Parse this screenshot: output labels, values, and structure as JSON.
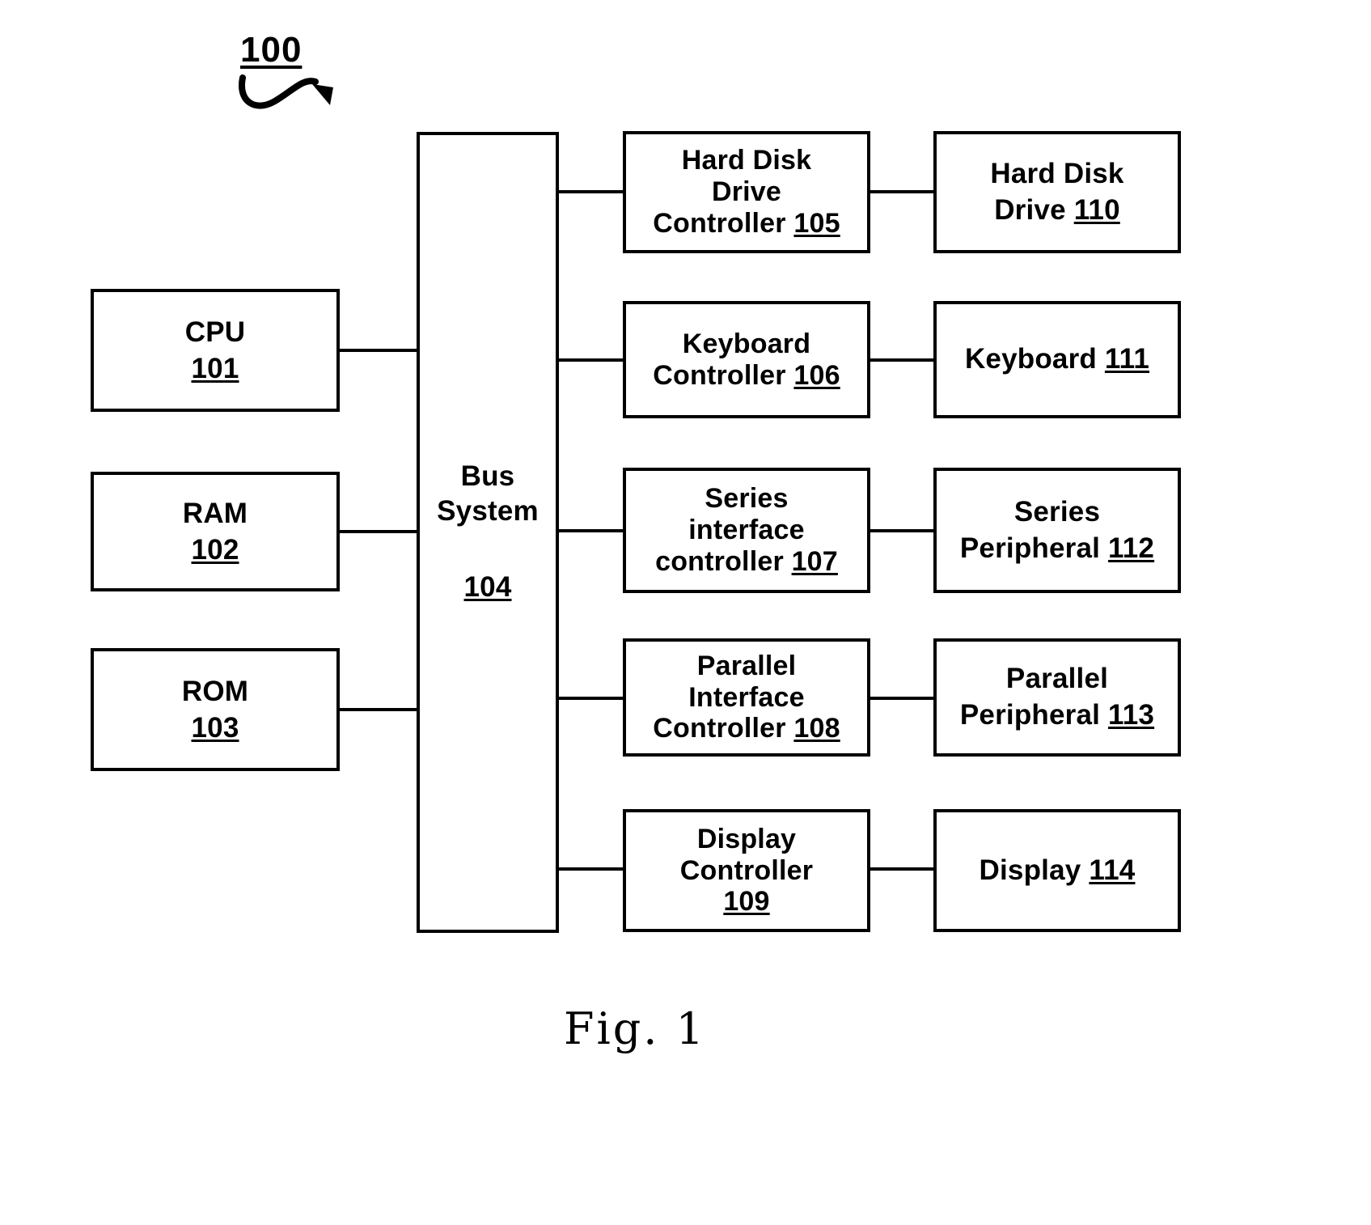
{
  "figure": {
    "reference_label": "100",
    "caption": "Fig. 1"
  },
  "left_column": [
    {
      "name": "cpu",
      "line1": "CPU",
      "ref": "101"
    },
    {
      "name": "ram",
      "line1": "RAM",
      "ref": "102"
    },
    {
      "name": "rom",
      "line1": "ROM",
      "ref": "103"
    }
  ],
  "bus": {
    "line1": "Bus",
    "line2": "System",
    "ref": "104"
  },
  "controllers": [
    {
      "name": "hard-disk-drive-controller",
      "line1": "Hard Disk",
      "line2": "Drive",
      "line3": "Controller",
      "ref": "105"
    },
    {
      "name": "keyboard-controller",
      "line1": "Keyboard",
      "line2": "Controller",
      "ref": "106"
    },
    {
      "name": "series-interface-controller",
      "line1": "Series",
      "line2": "interface",
      "line3": "controller",
      "ref": "107"
    },
    {
      "name": "parallel-interface-controller",
      "line1": "Parallel",
      "line2": "Interface",
      "line3": "Controller",
      "ref": "108"
    },
    {
      "name": "display-controller",
      "line1": "Display",
      "line2": "Controller",
      "ref": "109"
    }
  ],
  "devices": [
    {
      "name": "hard-disk-drive",
      "line1": "Hard Disk",
      "line2": "Drive",
      "ref": "110"
    },
    {
      "name": "keyboard",
      "line1": "Keyboard",
      "ref": "111"
    },
    {
      "name": "series-peripheral",
      "line1": "Series",
      "line2": "Peripheral",
      "ref": "112"
    },
    {
      "name": "parallel-peripheral",
      "line1": "Parallel",
      "line2": "Peripheral",
      "ref": "113"
    },
    {
      "name": "display",
      "line1": "Display",
      "ref": "114"
    }
  ],
  "colors": {
    "stroke": "#000000",
    "background": "#ffffff"
  }
}
